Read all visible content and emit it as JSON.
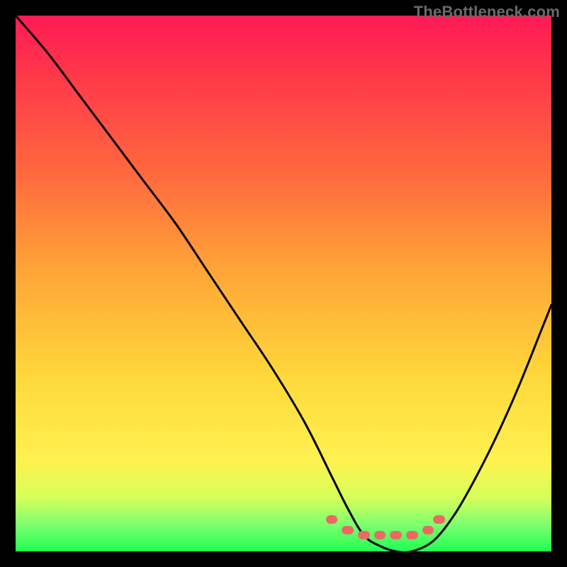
{
  "watermark": "TheBottleneck.com",
  "chart_data": {
    "type": "line",
    "title": "",
    "xlabel": "",
    "ylabel": "",
    "xlim": [
      0,
      100
    ],
    "ylim": [
      0,
      100
    ],
    "grid": false,
    "legend": false,
    "background_gradient": [
      "#ff1a55",
      "#ff6a3e",
      "#ffd93b",
      "#1fff52"
    ],
    "series": [
      {
        "name": "bottleneck-curve",
        "color": "#000000",
        "x": [
          0,
          6,
          12,
          18,
          24,
          30,
          36,
          42,
          48,
          54,
          59,
          62,
          65,
          68,
          71,
          74,
          78,
          82,
          86,
          90,
          94,
          98,
          100
        ],
        "values": [
          100,
          93,
          85,
          77,
          69,
          61,
          52,
          43,
          34,
          24,
          14,
          8,
          3,
          1,
          0,
          0,
          2,
          7,
          14,
          22,
          31,
          41,
          46
        ]
      }
    ],
    "markers": {
      "name": "optimal-zone",
      "color": "#ea6a63",
      "shape": "rounded-dash",
      "points": [
        {
          "x": 59,
          "y": 6,
          "w": 2.2,
          "h": 1.6
        },
        {
          "x": 62,
          "y": 4,
          "w": 2.2,
          "h": 1.6
        },
        {
          "x": 65,
          "y": 3,
          "w": 2.2,
          "h": 1.6
        },
        {
          "x": 68,
          "y": 3,
          "w": 2.2,
          "h": 1.6
        },
        {
          "x": 71,
          "y": 3,
          "w": 2.2,
          "h": 1.6
        },
        {
          "x": 74,
          "y": 3,
          "w": 2.2,
          "h": 1.6
        },
        {
          "x": 77,
          "y": 4,
          "w": 2.2,
          "h": 1.6
        },
        {
          "x": 79,
          "y": 6,
          "w": 2.2,
          "h": 1.6
        }
      ]
    }
  }
}
